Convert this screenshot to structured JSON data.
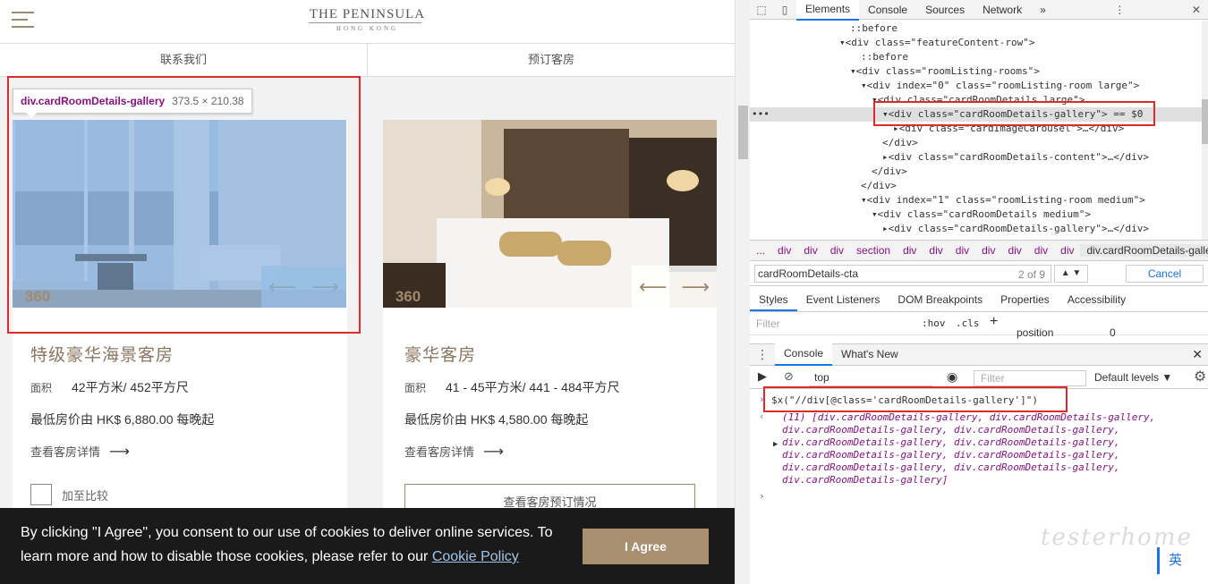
{
  "site": {
    "logo_main": "THE PENINSULA",
    "logo_sub": "HONG KONG",
    "nav": [
      "联系我们",
      "预订客房"
    ],
    "tooltip": {
      "selector": "div.cardRoomDetails-gallery",
      "size": "373.5 × 210.38"
    },
    "rooms": [
      {
        "title": "特级豪华海景客房",
        "area_label": "面积",
        "area": "42平方米/ 452平方尺",
        "price": "最低房价由 HK$ 6,880.00 每晚起",
        "link": "查看客房详情",
        "badge": "360",
        "compare": "加至比较"
      },
      {
        "title": "豪华客房",
        "area_label": "面积",
        "area": "41 - 45平方米/ 441 - 484平方尺",
        "price": "最低房价由 HK$ 4,580.00 每晚起",
        "link": "查看客房详情",
        "badge": "360",
        "booking": "查看客房预订情况"
      }
    ],
    "cookie": {
      "text": "By clicking \"I Agree\", you consent to our use of cookies to deliver online services. To learn more and how to disable those cookies, please refer to our ",
      "link": "Cookie Policy",
      "button": "I Agree"
    }
  },
  "devtools": {
    "tabs": [
      "Elements",
      "Console",
      "Sources",
      "Network"
    ],
    "more": "»",
    "dom": [
      {
        "t": "::before"
      },
      {
        "t": "▾<div class=\"featureContent-row\">"
      },
      {
        "t": "::before"
      },
      {
        "t": "▾<div class=\"roomListing-rooms\">"
      },
      {
        "t": "▾<div index=\"0\" class=\"roomListing-room large\">"
      },
      {
        "t": "▾<div class=\"cardRoomDetails large\">"
      },
      {
        "t": "▾<div class=\"cardRoomDetails-gallery\"> == $0"
      },
      {
        "t": "▸<div class=\"cardImageCarousel\">…</div>"
      },
      {
        "t": "</div>"
      },
      {
        "t": "▸<div class=\"cardRoomDetails-content\">…</div>"
      },
      {
        "t": "</div>"
      },
      {
        "t": "</div>"
      },
      {
        "t": "▾<div index=\"1\" class=\"roomListing-room medium\">"
      },
      {
        "t": "▾<div class=\"cardRoomDetails medium\">"
      },
      {
        "t": "▸<div class=\"cardRoomDetails-gallery\">…</div>"
      }
    ],
    "crumbs": [
      "...",
      "div",
      "div",
      "div",
      "section",
      "div",
      "div",
      "div",
      "div",
      "div",
      "div",
      "div",
      "div.cardRoomDetails-gallery"
    ],
    "search": {
      "value": "cardRoomDetails-cta",
      "count": "2 of 9",
      "cancel": "Cancel"
    },
    "subtabs": [
      "Styles",
      "Event Listeners",
      "DOM Breakpoints",
      "Properties",
      "Accessibility"
    ],
    "filter": {
      "placeholder": "Filter",
      "hov": ":hov",
      "cls": ".cls",
      "plus": "+"
    },
    "position": {
      "key": "position",
      "value": "0"
    },
    "drawer_tabs": [
      "Console",
      "What's New"
    ],
    "console_toolbar": {
      "context": "top",
      "filter": "Filter",
      "levels": "Default levels ▼"
    },
    "command": "$x(\"//div[@class='cardRoomDetails-gallery']\")",
    "result": [
      "(11) [div.cardRoomDetails-gallery, div.cardRoomDetails-gallery,",
      "div.cardRoomDetails-gallery, div.cardRoomDetails-gallery,",
      "div.cardRoomDetails-gallery, div.cardRoomDetails-gallery,",
      "div.cardRoomDetails-gallery, div.cardRoomDetails-gallery,",
      "div.cardRoomDetails-gallery, div.cardRoomDetails-gallery,",
      "div.cardRoomDetails-gallery]"
    ]
  },
  "watermark": "testerhome",
  "ime": "英"
}
